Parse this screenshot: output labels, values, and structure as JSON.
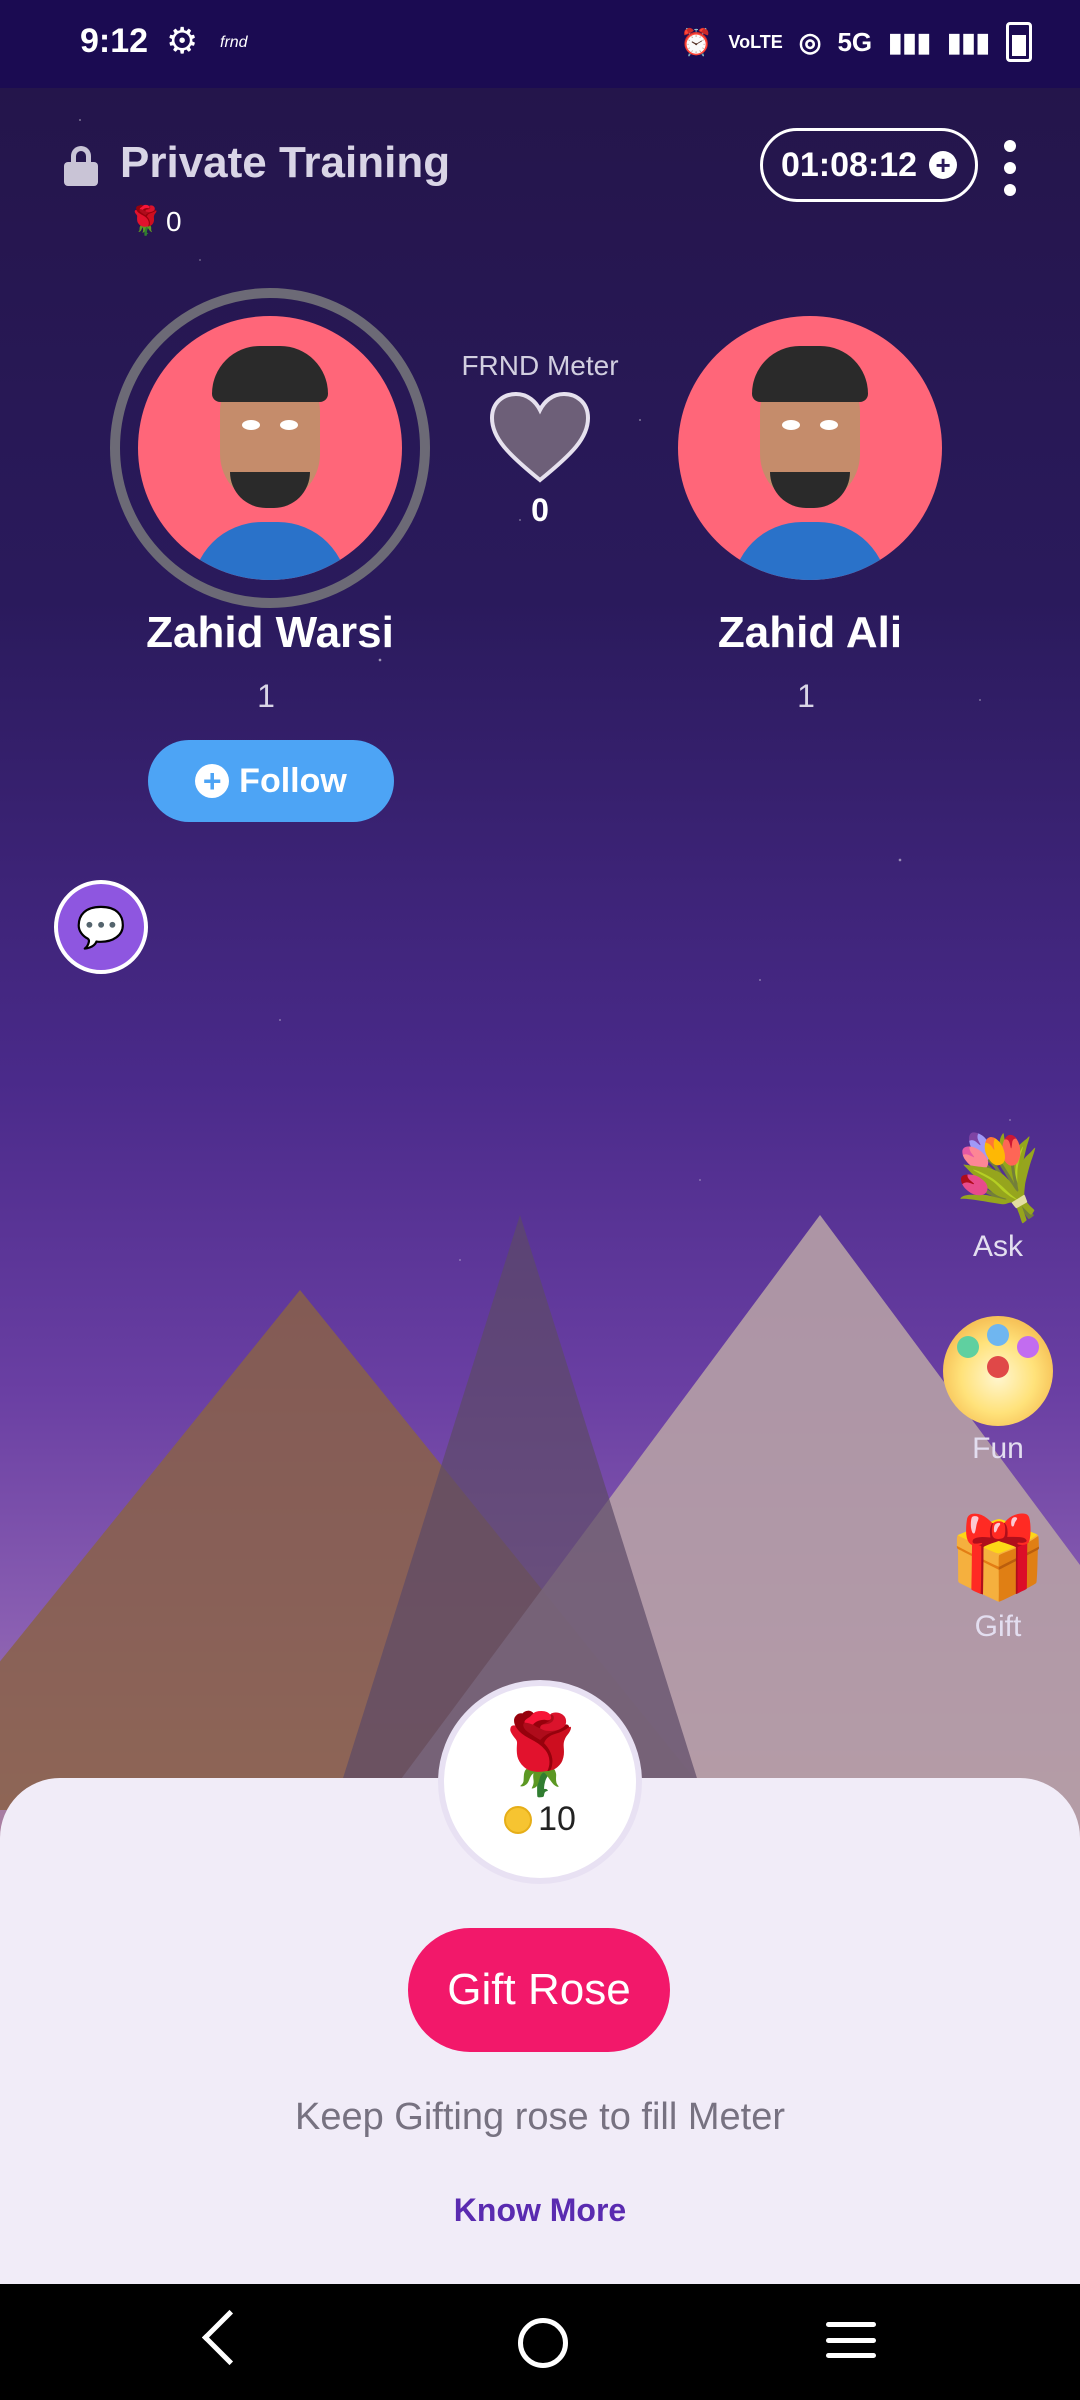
{
  "status": {
    "time": "9:12",
    "app_label": "frnd",
    "network": "5G"
  },
  "header": {
    "title": "Private Training",
    "rose_count": "0",
    "timer": "01:08:12"
  },
  "users": {
    "left": {
      "name": "Zahid Warsi",
      "count": "1"
    },
    "right": {
      "name": "Zahid Ali",
      "count": "1"
    }
  },
  "meter": {
    "label": "FRND Meter",
    "value": "0"
  },
  "follow": {
    "label": "Follow"
  },
  "side_actions": [
    {
      "label": "Ask",
      "icon": "bouquet-icon"
    },
    {
      "label": "Fun",
      "icon": "fun-balls-icon"
    },
    {
      "label": "Gift",
      "icon": "gift-box-icon"
    }
  ],
  "sheet": {
    "price": "10",
    "button_label": "Gift Rose",
    "hint": "Keep Gifting rose to fill Meter",
    "link": "Know More"
  },
  "colors": {
    "accent_pink": "#f2186a",
    "follow_blue": "#4da4f5",
    "status_bar": "#1b0b52",
    "link_purple": "#5a2bb0"
  }
}
